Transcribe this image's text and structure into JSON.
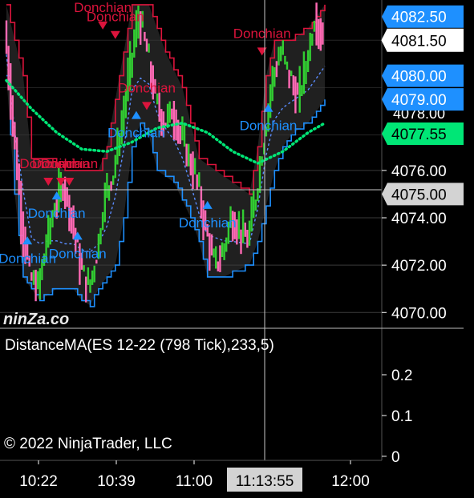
{
  "watermark": {
    "brand": "ninZa.co"
  },
  "price_panel": {
    "y_ticks": [
      "4070.00",
      "4072.00",
      "4074.00",
      "4076.00"
    ],
    "badges": [
      {
        "text": "4082.50",
        "value": 4082.5,
        "bg": "#1e90ff",
        "fg": "#ffffff"
      },
      {
        "text": "4081.50",
        "value": 4081.5,
        "bg": "#ffffff",
        "fg": "#000000"
      },
      {
        "text": "4080.00",
        "value": 4080.0,
        "bg": "#1e90ff",
        "fg": "#ffffff"
      },
      {
        "text": "4079.00",
        "value": 4079.0,
        "bg": "#1e90ff",
        "fg": "#ffffff"
      },
      {
        "text": "4077.55",
        "value": 4077.55,
        "bg": "#00e676",
        "fg": "#000000"
      },
      {
        "text": "4075.00",
        "value": 4075.0,
        "bg": "#d3d3d3",
        "fg": "#000000"
      }
    ],
    "partial_label": "4078.00"
  },
  "indicator_panel": {
    "title": "DistanceMA(ES 12-22 (798 Tick),233,5)",
    "y_ticks": [
      "0.2",
      "0.1",
      "0"
    ],
    "copyright": "© 2022 NinjaTrader, LLC"
  },
  "time_axis": {
    "ticks": [
      "10:22",
      "10:39",
      "11:00",
      "12:00"
    ],
    "crosshair_label": "11:13:55"
  },
  "colors": {
    "up_bar": "#32cd32",
    "down_bar": "#ff69b4",
    "channel": "#1e90ff",
    "ma": "#00e676",
    "signal_sell": "#dc143c",
    "signal_buy": "#1e90ff",
    "grid": "#3a3a3a",
    "crosshair": "#c8c8c8"
  },
  "chart_data": {
    "type": "candlestick",
    "ylim": [
      4069.4,
      4083.2
    ],
    "y_ticks": [
      4070,
      4072,
      4074,
      4076
    ],
    "x_ticks": [
      "10:22",
      "10:39",
      "11:00",
      "12:00"
    ],
    "price_series": [
      [
        0,
        4082.0
      ],
      [
        4,
        4078.0
      ],
      [
        8,
        4074.0
      ],
      [
        12,
        4071.5
      ],
      [
        16,
        4071.0
      ],
      [
        20,
        4073.0
      ],
      [
        24,
        4074.5
      ],
      [
        28,
        4075.5
      ],
      [
        32,
        4074.0
      ],
      [
        36,
        4072.0
      ],
      [
        40,
        4071.0
      ],
      [
        44,
        4072.5
      ],
      [
        48,
        4075.0
      ],
      [
        52,
        4076.0
      ],
      [
        56,
        4078.0
      ],
      [
        60,
        4080.5
      ],
      [
        64,
        4082.5
      ],
      [
        68,
        4081.0
      ],
      [
        72,
        4079.0
      ],
      [
        76,
        4078.0
      ],
      [
        80,
        4078.5
      ],
      [
        84,
        4077.5
      ],
      [
        88,
        4076.5
      ],
      [
        92,
        4075.5
      ],
      [
        96,
        4073.5
      ],
      [
        100,
        4072.0
      ],
      [
        104,
        4072.5
      ],
      [
        108,
        4074.0
      ],
      [
        112,
        4073.5
      ],
      [
        116,
        4073.0
      ],
      [
        120,
        4075.0
      ],
      [
        124,
        4077.5
      ],
      [
        128,
        4080.0
      ],
      [
        132,
        4081.0
      ],
      [
        136,
        4080.0
      ],
      [
        140,
        4079.0
      ],
      [
        144,
        4080.5
      ],
      [
        148,
        4082.5
      ],
      [
        152,
        4081.5
      ]
    ],
    "donchian_upper": [
      [
        0,
        4083.0
      ],
      [
        8,
        4080.0
      ],
      [
        12,
        4076.5
      ],
      [
        20,
        4076.5
      ],
      [
        28,
        4076.0
      ],
      [
        36,
        4076.0
      ],
      [
        44,
        4076.0
      ],
      [
        48,
        4077.0
      ],
      [
        56,
        4081.0
      ],
      [
        60,
        4083.0
      ],
      [
        68,
        4083.0
      ],
      [
        76,
        4081.0
      ],
      [
        84,
        4079.5
      ],
      [
        92,
        4076.5
      ],
      [
        100,
        4076.0
      ],
      [
        108,
        4075.5
      ],
      [
        116,
        4075.0
      ],
      [
        120,
        4077.0
      ],
      [
        124,
        4080.0
      ],
      [
        128,
        4081.5
      ],
      [
        136,
        4081.5
      ],
      [
        144,
        4082.0
      ],
      [
        152,
        4083.0
      ]
    ],
    "donchian_lower": [
      [
        0,
        4080.0
      ],
      [
        4,
        4075.0
      ],
      [
        8,
        4071.5
      ],
      [
        12,
        4071.0
      ],
      [
        16,
        4070.5
      ],
      [
        24,
        4071.0
      ],
      [
        32,
        4071.0
      ],
      [
        36,
        4070.5
      ],
      [
        40,
        4070.3
      ],
      [
        44,
        4071.0
      ],
      [
        52,
        4072.0
      ],
      [
        56,
        4074.0
      ],
      [
        60,
        4077.0
      ],
      [
        64,
        4078.0
      ],
      [
        68,
        4077.5
      ],
      [
        72,
        4076.0
      ],
      [
        80,
        4075.5
      ],
      [
        88,
        4074.0
      ],
      [
        92,
        4073.0
      ],
      [
        96,
        4071.5
      ],
      [
        104,
        4071.5
      ],
      [
        108,
        4071.7
      ],
      [
        116,
        4072.0
      ],
      [
        120,
        4073.0
      ],
      [
        124,
        4074.5
      ],
      [
        128,
        4076.0
      ],
      [
        132,
        4077.0
      ],
      [
        136,
        4077.5
      ],
      [
        144,
        4078.0
      ],
      [
        152,
        4079.0
      ]
    ],
    "moving_average": [
      [
        0,
        4079.8
      ],
      [
        12,
        4078.6
      ],
      [
        24,
        4077.6
      ],
      [
        36,
        4076.9
      ],
      [
        48,
        4076.8
      ],
      [
        60,
        4077.2
      ],
      [
        72,
        4077.8
      ],
      [
        84,
        4078.0
      ],
      [
        96,
        4077.6
      ],
      [
        108,
        4076.8
      ],
      [
        120,
        4076.3
      ],
      [
        132,
        4076.8
      ],
      [
        144,
        4077.6
      ],
      [
        152,
        4078.0
      ]
    ],
    "donchian_signals": [
      {
        "x": 46,
        "y": 4082.9,
        "type": "sell",
        "label": "Donchian"
      },
      {
        "x": 52,
        "y": 4082.5,
        "type": "sell",
        "label": "Donchian"
      },
      {
        "x": 67,
        "y": 4079.5,
        "type": "sell",
        "label": "Donchian"
      },
      {
        "x": 20,
        "y": 4076.3,
        "type": "sell",
        "label": "Donchian"
      },
      {
        "x": 26,
        "y": 4076.3,
        "type": "sell",
        "label": "Donchian"
      },
      {
        "x": 30,
        "y": 4076.3,
        "type": "sell",
        "label": "Donchian"
      },
      {
        "x": 122,
        "y": 4081.8,
        "type": "sell",
        "label": "Donchian"
      },
      {
        "x": 62,
        "y": 4077.6,
        "type": "buy",
        "label": "Donchian"
      },
      {
        "x": 125,
        "y": 4077.9,
        "type": "buy",
        "label": "Donchian"
      },
      {
        "x": 10,
        "y": 4072.3,
        "type": "buy",
        "label": "Donchian"
      },
      {
        "x": 24,
        "y": 4074.2,
        "type": "buy",
        "label": "Donchian"
      },
      {
        "x": 34,
        "y": 4072.5,
        "type": "buy",
        "label": "Donchian"
      },
      {
        "x": 96,
        "y": 4073.8,
        "type": "buy",
        "label": "Donchian"
      }
    ],
    "indicator": {
      "name": "DistanceMA(ES 12-22 (798 Tick),233,5)",
      "ylim": [
        -0.01,
        0.31
      ],
      "y_ticks": [
        0.2,
        0.1,
        0
      ]
    }
  }
}
